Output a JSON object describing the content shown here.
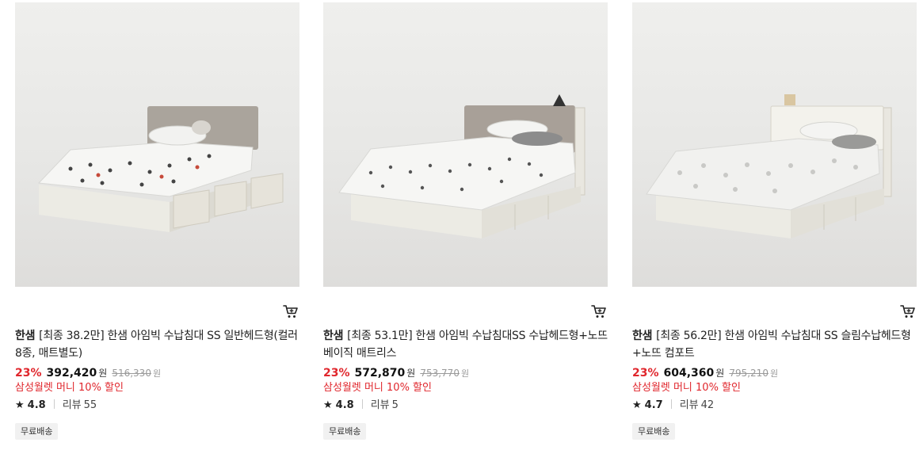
{
  "products": [
    {
      "brand": "한샘",
      "name": "[최종 38.2만] 한샘 아임빅 수납침대 SS 일반헤드형(컬러8종, 매트별도)",
      "discount": "23%",
      "price": "392,420",
      "currency": "원",
      "original_price": "516,330",
      "promo": "삼성월렛 머니 10% 할인",
      "rating": "4.8",
      "reviews_label": "리뷰",
      "reviews": "55",
      "badge": "무료배송"
    },
    {
      "brand": "한샘",
      "name": "[최종 53.1만] 한샘 아임빅 수납침대SS 수납헤드형+노뜨 베이직 매트리스",
      "discount": "23%",
      "price": "572,870",
      "currency": "원",
      "original_price": "753,770",
      "promo": "삼성월렛 머니 10% 할인",
      "rating": "4.8",
      "reviews_label": "리뷰",
      "reviews": "5",
      "badge": "무료배송"
    },
    {
      "brand": "한샘",
      "name": "[최종 56.2만] 한샘 아임빅 수납침대 SS 슬림수납헤드형+노뜨 컴포트",
      "discount": "23%",
      "price": "604,360",
      "currency": "원",
      "original_price": "795,210",
      "promo": "삼성월렛 머니 10% 할인",
      "rating": "4.7",
      "reviews_label": "리뷰",
      "reviews": "42",
      "badge": "무료배송"
    }
  ],
  "icons": {
    "cart": "cart-icon",
    "star": "star-icon"
  },
  "colors": {
    "discount": "#e0262c",
    "promo": "#e0262c",
    "badge_bg": "#f1f1f1"
  }
}
